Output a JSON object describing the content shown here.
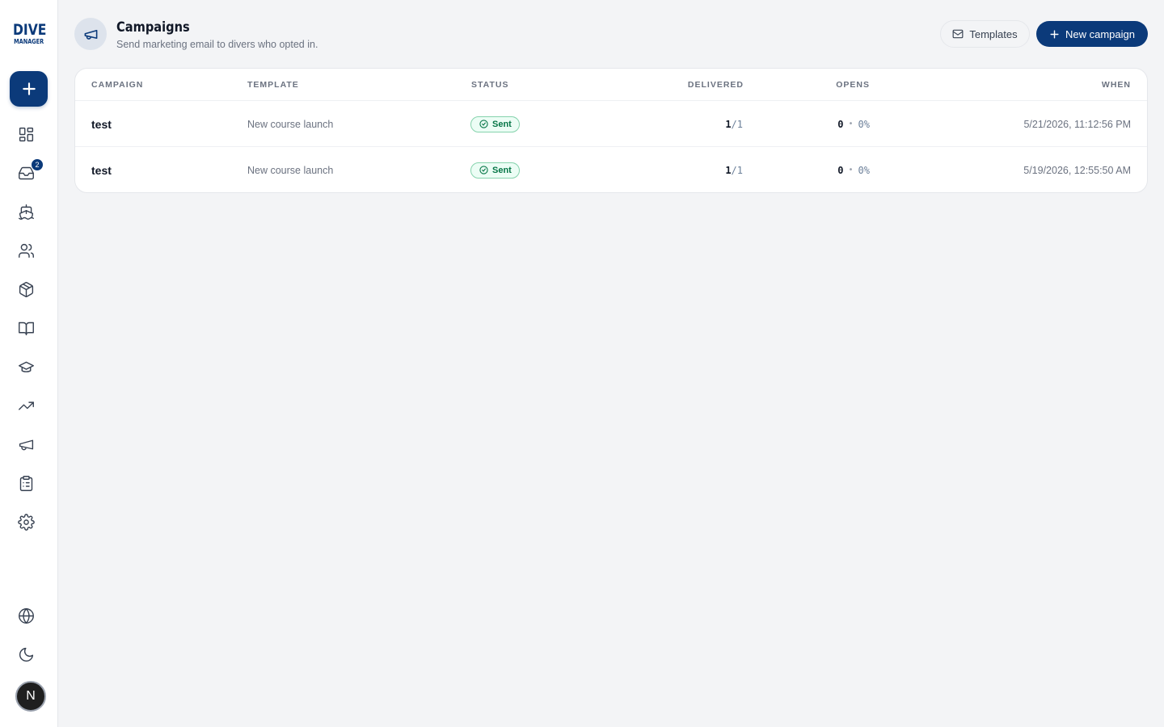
{
  "brand": {
    "line1": "DIVE",
    "line2": "MANAGER"
  },
  "sidebar": {
    "add_icon": "plus-icon",
    "items": [
      {
        "icon": "dashboard-icon",
        "label": "Dashboard"
      },
      {
        "icon": "inbox-icon",
        "badge": "2"
      },
      {
        "icon": "boat-icon"
      },
      {
        "icon": "users-icon"
      },
      {
        "icon": "box-icon"
      },
      {
        "icon": "book-icon"
      },
      {
        "icon": "graduation-cap-icon"
      },
      {
        "icon": "trending-up-icon"
      },
      {
        "icon": "megaphone-icon"
      },
      {
        "icon": "clipboard-icon"
      },
      {
        "icon": "gear-icon"
      }
    ],
    "bottom": [
      {
        "icon": "globe-icon"
      },
      {
        "icon": "moon-icon"
      }
    ],
    "avatar_letter": "N"
  },
  "header": {
    "title": "Campaigns",
    "subtitle": "Send marketing email to divers who opted in.",
    "templates_label": "Templates",
    "new_campaign_label": "New campaign"
  },
  "table": {
    "columns": [
      "Campaign",
      "Template",
      "Status",
      "Delivered",
      "Opens",
      "When"
    ],
    "rows": [
      {
        "name": "test",
        "template": "New course launch",
        "status": "Sent",
        "delivered": "1",
        "delivered_total": "/1",
        "opens": "0",
        "open_rate": "0%",
        "when": "5/21/2026, 11:12:56 PM"
      },
      {
        "name": "test",
        "template": "New course launch",
        "status": "Sent",
        "delivered": "1",
        "delivered_total": "/1",
        "opens": "0",
        "open_rate": "0%",
        "when": "5/19/2026, 12:55:50 AM"
      }
    ]
  },
  "colors": {
    "brand": "#0b3a7a",
    "success": "#067647",
    "background": "#f3f4f6"
  }
}
